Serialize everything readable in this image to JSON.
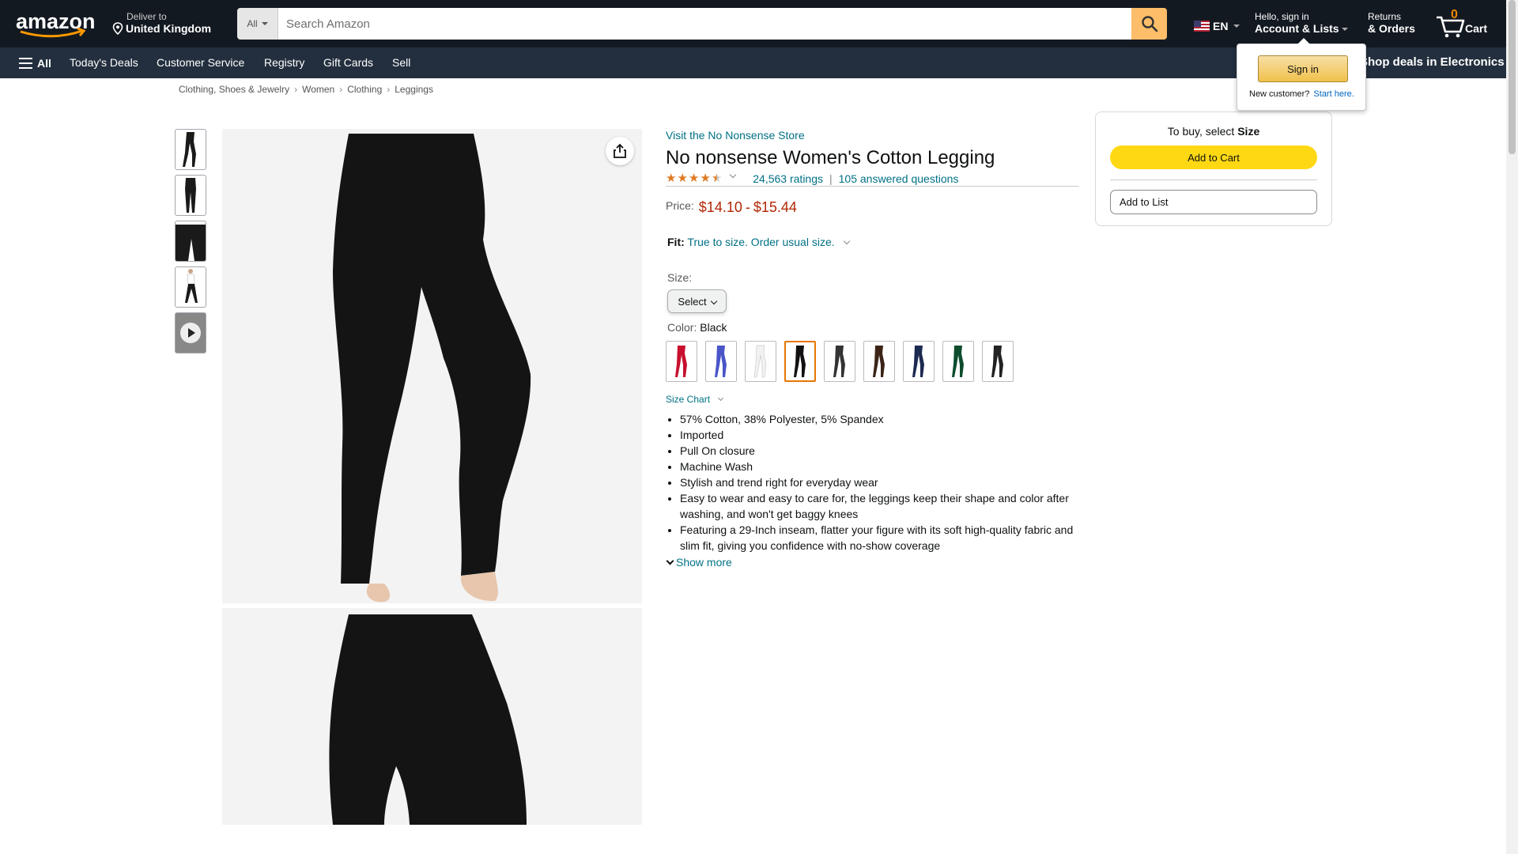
{
  "header": {
    "deliver_line1": "Deliver to",
    "deliver_line2": "United Kingdom",
    "search_category": "All",
    "search_placeholder": "Search Amazon",
    "language": "EN",
    "account_line1": "Hello, sign in",
    "account_line2": "Account & Lists",
    "returns_line1": "Returns",
    "returns_line2": "& Orders",
    "cart_count": "0",
    "cart_label": "Cart"
  },
  "nav": {
    "all": "All",
    "items": [
      "Today's Deals",
      "Customer Service",
      "Registry",
      "Gift Cards",
      "Sell"
    ],
    "promo": "Shop deals in Electronics"
  },
  "signin_popover": {
    "button": "Sign in",
    "new_customer": "New customer?",
    "start_here": "Start here."
  },
  "breadcrumb": [
    "Clothing, Shoes & Jewelry",
    "Women",
    "Clothing",
    "Leggings"
  ],
  "product": {
    "store_link": "Visit the No Nonsense Store",
    "title": "No nonsense Women's Cotton Legging",
    "rating_value": 4.5,
    "ratings_count": "24,563 ratings",
    "answered": "105 answered questions",
    "price_label": "Price:",
    "price_low": "$14.10",
    "price_sep": "-",
    "price_high": "$15.44",
    "fit_label": "Fit:",
    "fit_value": "True to size. Order usual size.",
    "size_label": "Size:",
    "size_select": "Select",
    "color_label": "Color:",
    "color_value": "Black",
    "swatches": [
      {
        "name": "red",
        "color": "#c8102e"
      },
      {
        "name": "blue",
        "color": "#4a55c8"
      },
      {
        "name": "white",
        "color": "#f2f2f2"
      },
      {
        "name": "black",
        "color": "#111111"
      },
      {
        "name": "charcoal",
        "color": "#333333"
      },
      {
        "name": "brown",
        "color": "#3b2417"
      },
      {
        "name": "navy",
        "color": "#1c2951"
      },
      {
        "name": "green",
        "color": "#0d4d2d"
      },
      {
        "name": "black-print",
        "color": "#222222"
      }
    ],
    "size_chart": "Size Chart",
    "bullets": [
      "57% Cotton, 38% Polyester, 5% Spandex",
      "Imported",
      "Pull On closure",
      "Machine Wash",
      "Stylish and trend right for everyday wear",
      "Easy to wear and easy to care for, the leggings keep their shape and color after washing, and won't get baggy knees",
      "Featuring a 29-Inch inseam, flatter your figure with its soft high-quality fabric and slim fit, giving you confidence with no-show coverage"
    ],
    "show_more": "Show more"
  },
  "buybox": {
    "prompt_prefix": "To buy, select",
    "prompt_bold": "Size",
    "add_to_cart": "Add to Cart",
    "add_to_list": "Add to List"
  },
  "colors": {
    "header_bg": "#131921",
    "subnav_bg": "#232f3e",
    "search_btn": "#febd69",
    "add_to_cart": "#ffd814",
    "price": "#b12704",
    "link": "#007185",
    "star": "#de7921"
  }
}
